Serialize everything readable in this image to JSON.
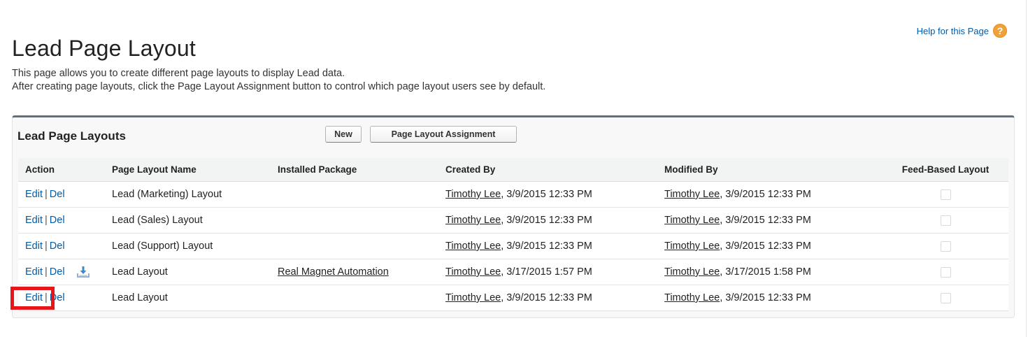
{
  "header": {
    "title": "Lead Page Layout",
    "help_label": "Help for this Page",
    "help_icon": "?"
  },
  "description": {
    "line1": "This page allows you to create different page layouts to display Lead data.",
    "line2": "After creating page layouts, click the Page Layout Assignment button to control which page layout users see by default."
  },
  "panel": {
    "title": "Lead Page Layouts",
    "new_button": "New",
    "assign_button": "Page Layout Assignment",
    "columns": [
      "Action",
      "Page Layout Name",
      "Installed Package",
      "Created By",
      "Modified By",
      "Feed-Based Layout"
    ],
    "rows": [
      {
        "edit": "Edit",
        "sep": "|",
        "del": "Del",
        "name": "Lead (Marketing) Layout",
        "package": "",
        "created_user": "Timothy Lee",
        "created_date": ", 3/9/2015 12:33 PM",
        "modified_user": "Timothy Lee",
        "modified_date": ", 3/9/2015 12:33 PM",
        "feed_based": false
      },
      {
        "edit": "Edit",
        "sep": "|",
        "del": "Del",
        "name": "Lead (Sales) Layout",
        "package": "",
        "created_user": "Timothy Lee",
        "created_date": ", 3/9/2015 12:33 PM",
        "modified_user": "Timothy Lee",
        "modified_date": ", 3/9/2015 12:33 PM",
        "feed_based": false
      },
      {
        "edit": "Edit",
        "sep": "|",
        "del": "Del",
        "name": "Lead (Support) Layout",
        "package": "",
        "created_user": "Timothy Lee",
        "created_date": ", 3/9/2015 12:33 PM",
        "modified_user": "Timothy Lee",
        "modified_date": ", 3/9/2015 12:33 PM",
        "feed_based": false
      },
      {
        "edit": "Edit",
        "sep": "|",
        "del": "Del",
        "name": "Lead Layout",
        "package": "Real Magnet Automation",
        "created_user": "Timothy Lee",
        "created_date": ", 3/17/2015 1:57 PM",
        "modified_user": "Timothy Lee",
        "modified_date": ", 3/17/2015 1:58 PM",
        "feed_based": false,
        "installed_icon": "package-download-icon"
      },
      {
        "edit": "Edit",
        "sep": "|",
        "del": "Del",
        "name": "Lead Layout",
        "package": "",
        "created_user": "Timothy Lee",
        "created_date": ", 3/9/2015 12:33 PM",
        "modified_user": "Timothy Lee",
        "modified_date": ", 3/9/2015 12:33 PM",
        "feed_based": false
      }
    ]
  },
  "colors": {
    "link": "#015ba7",
    "panel_top_border": "#5f7083",
    "highlight": "#e8151b",
    "help_icon": "#f0a23a"
  }
}
